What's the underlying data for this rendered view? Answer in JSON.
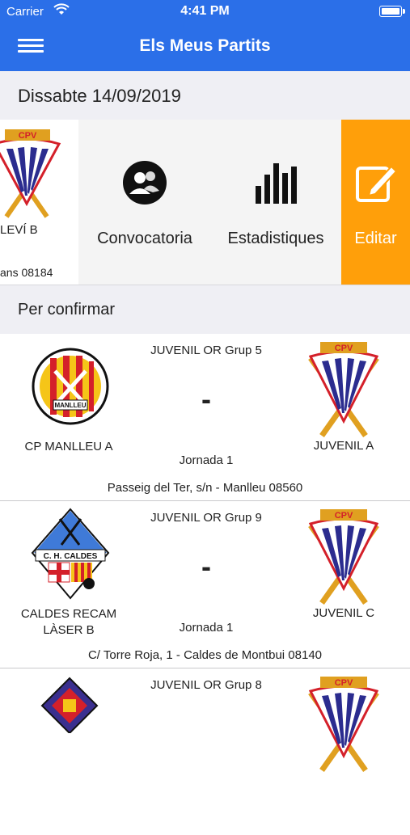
{
  "status_bar": {
    "carrier": "Carrier",
    "time": "4:41 PM"
  },
  "nav": {
    "title": "Els Meus Partits",
    "menu_icon": "hamburger-menu-icon"
  },
  "date_header": "Dissabte 14/09/2019",
  "swiped_row": {
    "team_fragment": "LEVÍ B",
    "address_fragment": "ans 08184",
    "actions": [
      {
        "label": "Convocatoria",
        "icon": "people-icon"
      },
      {
        "label": "Estadistiques",
        "icon": "bar-chart-icon"
      },
      {
        "label": "Editar",
        "icon": "edit-icon",
        "color": "#ff9f0a"
      }
    ]
  },
  "section_header": "Per confirmar",
  "matches": [
    {
      "group": "JUVENIL OR Grup 5",
      "score": "-",
      "home": "CP MANLLEU A",
      "away": "JUVENIL A",
      "round": "Jornada 1",
      "address": "Passeig del Ter, s/n - Manlleu 08560",
      "home_logo_text": "MANLLEU"
    },
    {
      "group": "JUVENIL OR Grup 9",
      "score": "-",
      "home": "CALDES RECAM LÀSER B",
      "away": "JUVENIL C",
      "round": "Jornada 1",
      "address": "C/ Torre Roja, 1 - Caldes de Montbui 08140",
      "home_logo_text": "C. H. CALDES"
    },
    {
      "group": "JUVENIL OR Grup 8"
    }
  ],
  "colors": {
    "nav_bar": "#2b6fe8",
    "edit_action": "#ff9f0a",
    "header_bg": "#efeff4"
  }
}
